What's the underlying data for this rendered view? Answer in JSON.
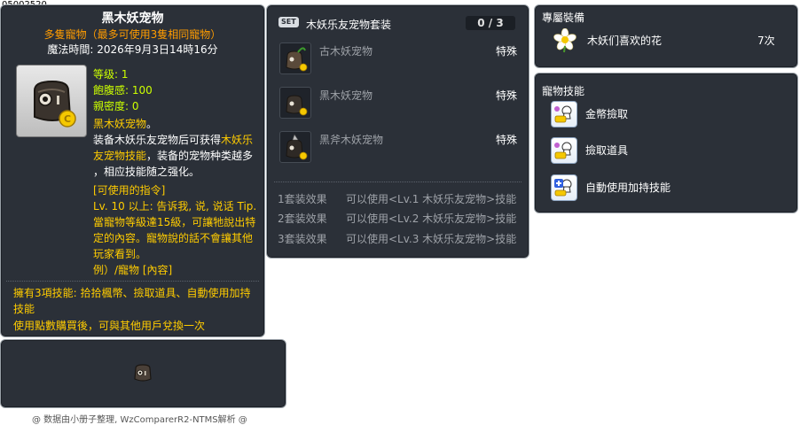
{
  "item_id": "05002520",
  "tooltip": {
    "title": "黑木妖宠物",
    "subtitle": "多隻寵物（最多可使用3隻相同寵物）",
    "magic_time": "魔法時間: 2026年9月3日14時16分",
    "stats": [
      {
        "label": "等级",
        "value": "1"
      },
      {
        "label": "飽腹感",
        "value": "100"
      },
      {
        "label": "親密度",
        "value": "0"
      }
    ],
    "desc_name": "黑木妖宠物",
    "desc_name_suffix": "。",
    "desc_line1": "装备木妖乐友宠物后可获得",
    "desc_hl1": "木妖乐",
    "desc_hl2": "友宠物技能",
    "desc_line2b": "，装备的宠物种类越多",
    "desc_line3": "，相应技能随之强化。",
    "cmd_title": "[可使用的指令]",
    "cmd_text": "Lv. 10 以上:  告诉我, 说, 说话 Tip. 當寵物等級達15級，可讓牠說出特定的內容。寵物說的話不會讓其他玩家看到。",
    "cmd_example": "例）/寵物 [內容]",
    "skills_note": "擁有3項技能: 拾拾楓幣、撿取道具、自動使用加持技能",
    "trade_note": "使用點數購買後，可與其他用戶兌換一次"
  },
  "set": {
    "badge": "SET",
    "name": "木妖乐友宠物套装",
    "count": "0 / 3",
    "items": [
      {
        "name": "古木妖宠物",
        "tag": "特殊"
      },
      {
        "name": "黑木妖宠物",
        "tag": "特殊"
      },
      {
        "name": "黑斧木妖宠物",
        "tag": "特殊"
      }
    ],
    "effects": [
      {
        "label": "1套装效果",
        "text": "可以使用<Lv.1 木妖乐友宠物>技能"
      },
      {
        "label": "2套装效果",
        "text": "可以使用<Lv.2 木妖乐友宠物>技能"
      },
      {
        "label": "3套装效果",
        "text": "可以使用<Lv.3 木妖乐友宠物>技能"
      }
    ]
  },
  "exclusive": {
    "title": "專屬裝備",
    "item_name": "木妖们喜欢的花",
    "item_count": "7次"
  },
  "pet_skills": {
    "title": "寵物技能",
    "items": [
      "金幣撿取",
      "撿取道具",
      "自動使用加持技能"
    ]
  },
  "footer": "@ 数据由小册子整理, WzComparerR2-NTMS解析 @"
}
